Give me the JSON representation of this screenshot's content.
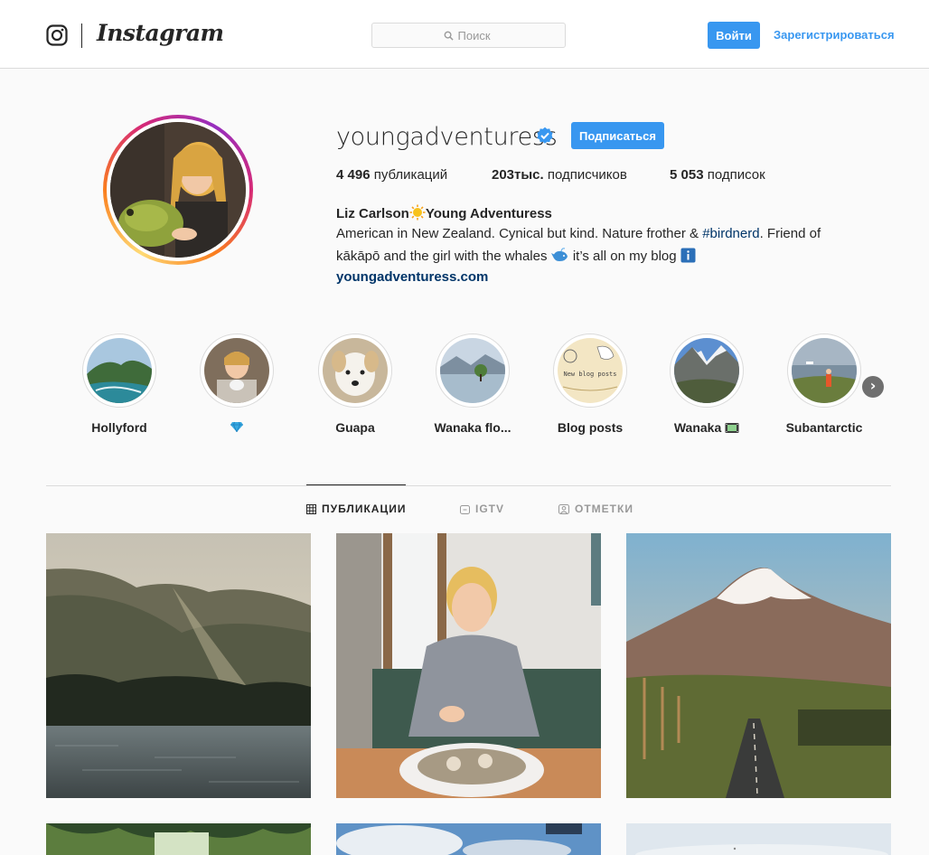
{
  "header": {
    "brand": "Instagram",
    "search": {
      "placeholder": "Поиск"
    },
    "login_label": "Войти",
    "signup_label": "Зарегистрироваться"
  },
  "profile": {
    "username": "youngadventuress",
    "verified": true,
    "follow_label": "Подписаться",
    "stats": {
      "posts_count": "4 496",
      "posts_label": "публикаций",
      "followers_count": "203тыс.",
      "followers_label": "подписчиков",
      "following_count": "5 053",
      "following_label": "подписок"
    },
    "full_name_part1": "Liz Carlson",
    "full_name_part2": "Young Adventuress",
    "bio_line1_a": "American in New Zealand. Cynical but kind. Nature frother & ",
    "bio_hashtag": "#birdnerd",
    "bio_line1_b": ". Friend of",
    "bio_line2_a": "kākāpō and the girl with the whales",
    "bio_line2_b": "it’s all on my blog",
    "website": "youngadventuress.com"
  },
  "highlights": [
    {
      "label": "Hollyford"
    },
    {
      "label": ""
    },
    {
      "label": "Guapa"
    },
    {
      "label": "Wanaka flo..."
    },
    {
      "label": "Blog posts"
    },
    {
      "label": "Wanaka"
    },
    {
      "label": "Subantarctic"
    }
  ],
  "highlight_blog_card_text": "New blog posts",
  "tabs": [
    {
      "label": "ПУБЛИКАЦИИ",
      "active": true
    },
    {
      "label": "IGTV",
      "active": false
    },
    {
      "label": "ОТМЕТКИ",
      "active": false
    }
  ],
  "colors": {
    "accent": "#3897f0",
    "link": "#003569",
    "text": "#262626",
    "border": "#dbdbdb",
    "background": "#fafafa"
  },
  "icons": [
    "instagram-glyph-icon",
    "search-icon",
    "verified-badge-icon",
    "chevron-right-icon",
    "grid-icon",
    "igtv-icon",
    "tagged-icon"
  ]
}
